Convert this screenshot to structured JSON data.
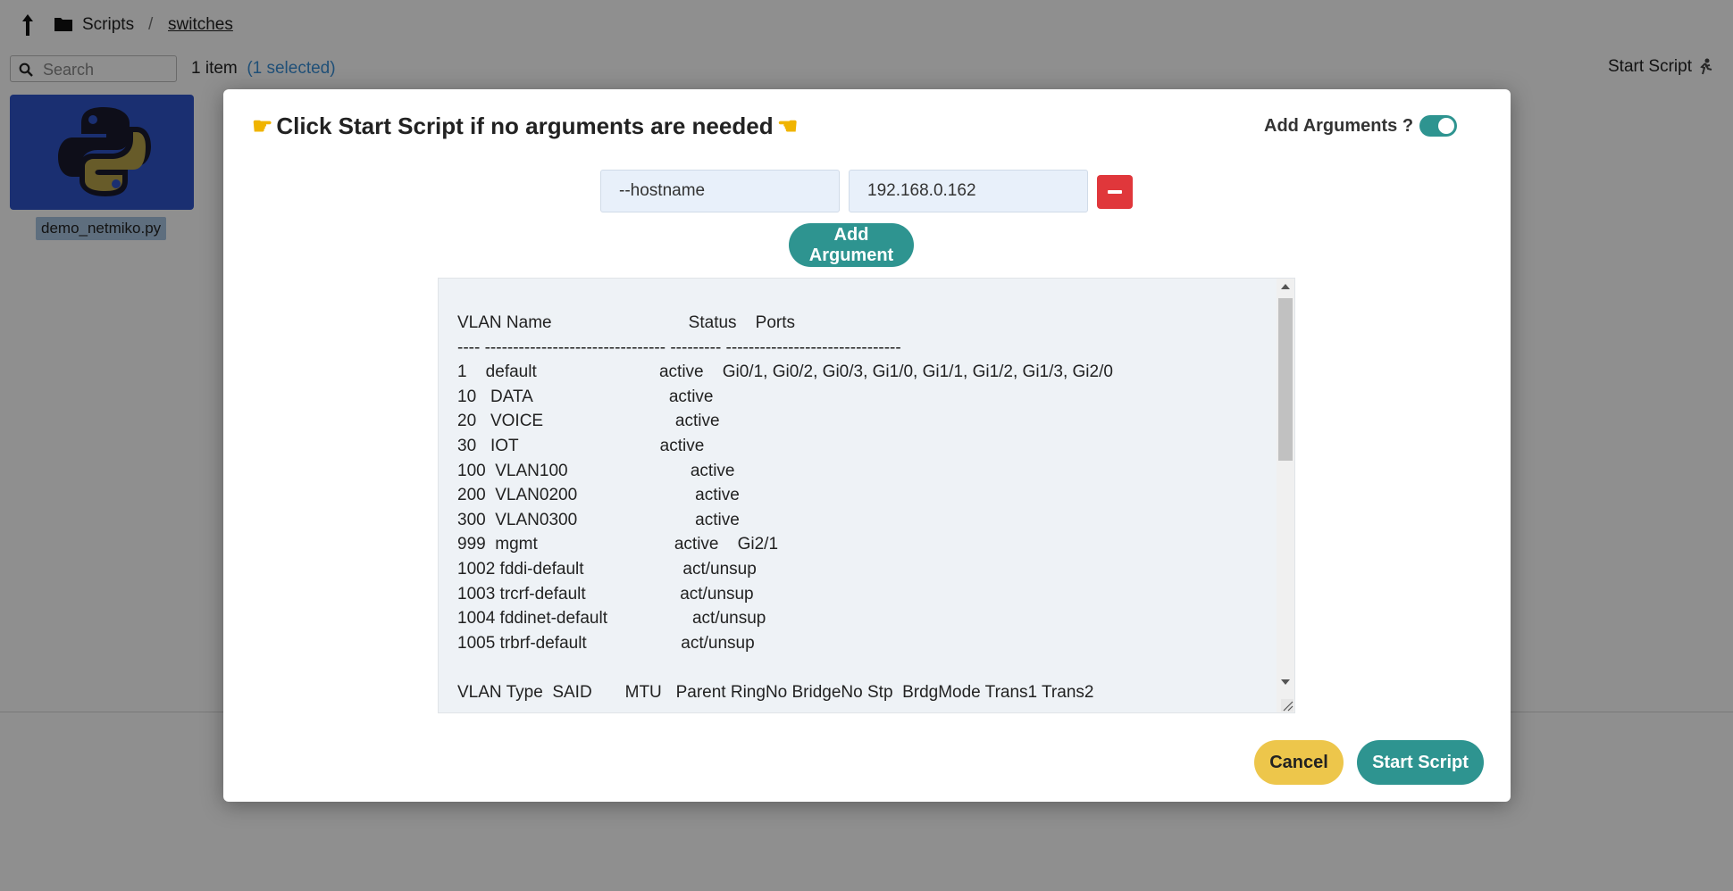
{
  "breadcrumb": {
    "root": "Scripts",
    "separator": "/",
    "current": "switches"
  },
  "search": {
    "placeholder": "Search"
  },
  "selection": {
    "count_text": "1 item",
    "selected_text": "(1 selected)"
  },
  "toolbar": {
    "start_script_label": "Start Script"
  },
  "files": [
    {
      "name": "demo_netmiko.py",
      "icon": "python-icon"
    }
  ],
  "modal": {
    "heading": "Click Start Script if no arguments are needed",
    "toggle_label": "Add Arguments ?",
    "toggle_on": true,
    "arguments": [
      {
        "name": "--hostname",
        "value": "192.168.0.162"
      }
    ],
    "add_argument_label": "Add Argument",
    "output_text": "VLAN Name                             Status    Ports\n---- -------------------------------- --------- -------------------------------\n1    default                          active    Gi0/1, Gi0/2, Gi0/3, Gi1/0, Gi1/1, Gi1/2, Gi1/3, Gi2/0\n10   DATA                             active\n20   VOICE                            active\n30   IOT                              active\n100  VLAN100                          active\n200  VLAN0200                         active\n300  VLAN0300                         active\n999  mgmt                             active    Gi2/1\n1002 fddi-default                     act/unsup\n1003 trcrf-default                    act/unsup\n1004 fddinet-default                  act/unsup\n1005 trbrf-default                    act/unsup\n\nVLAN Type  SAID       MTU   Parent RingNo BridgeNo Stp  BrdgMode Trans1 Trans2",
    "cancel_label": "Cancel",
    "start_label": "Start Script"
  },
  "colors": {
    "accent": "#2e9490",
    "danger": "#e0373b",
    "cancel": "#edc64b",
    "selected_link": "#3a8fd6"
  }
}
